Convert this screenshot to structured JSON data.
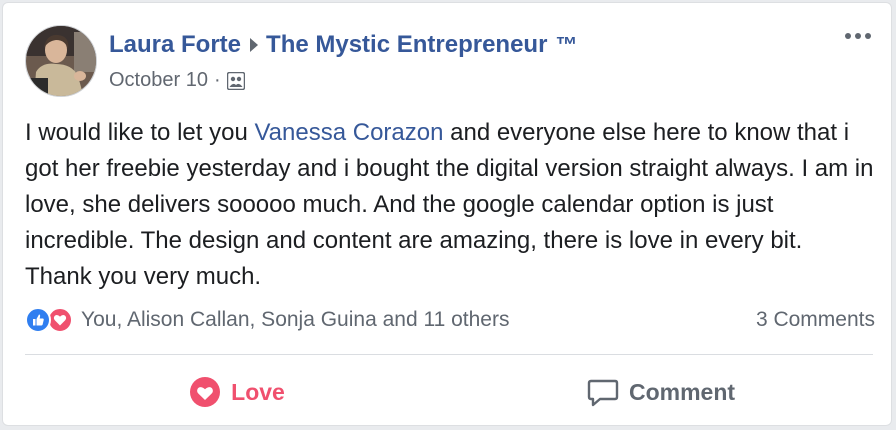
{
  "colors": {
    "link": "#365899",
    "text": "#1c1e21",
    "muted": "#606770",
    "love": "#f0506e",
    "like": "#2f7ef0"
  },
  "post": {
    "author": "Laura Forte",
    "group": "The Mystic Entrepreneur",
    "trademark": "™",
    "date": "October 10",
    "date_separator": "·",
    "audience_icon": "group-audience-icon",
    "more_icon": "more-options-icon",
    "body_before_mention": "I would like to let you ",
    "mention": "Vanessa Corazon",
    "body_after_mention": " and everyone else here to know that i got her freebie yesterday and i bought the digital version straight always. I am in love, she delivers sooooo much. And the google calendar option is just incredible. The design and content are amazing, there is love in every bit. Thank you very much."
  },
  "reactions": {
    "icons": [
      "like-reaction-icon",
      "love-reaction-icon"
    ],
    "summary": "You, Alison Callan, Sonja Guina and 11 others",
    "comments": "3 Comments"
  },
  "actions": {
    "love_label": "Love",
    "love_icon": "heart-icon",
    "comment_label": "Comment",
    "comment_icon": "comment-bubble-icon"
  }
}
